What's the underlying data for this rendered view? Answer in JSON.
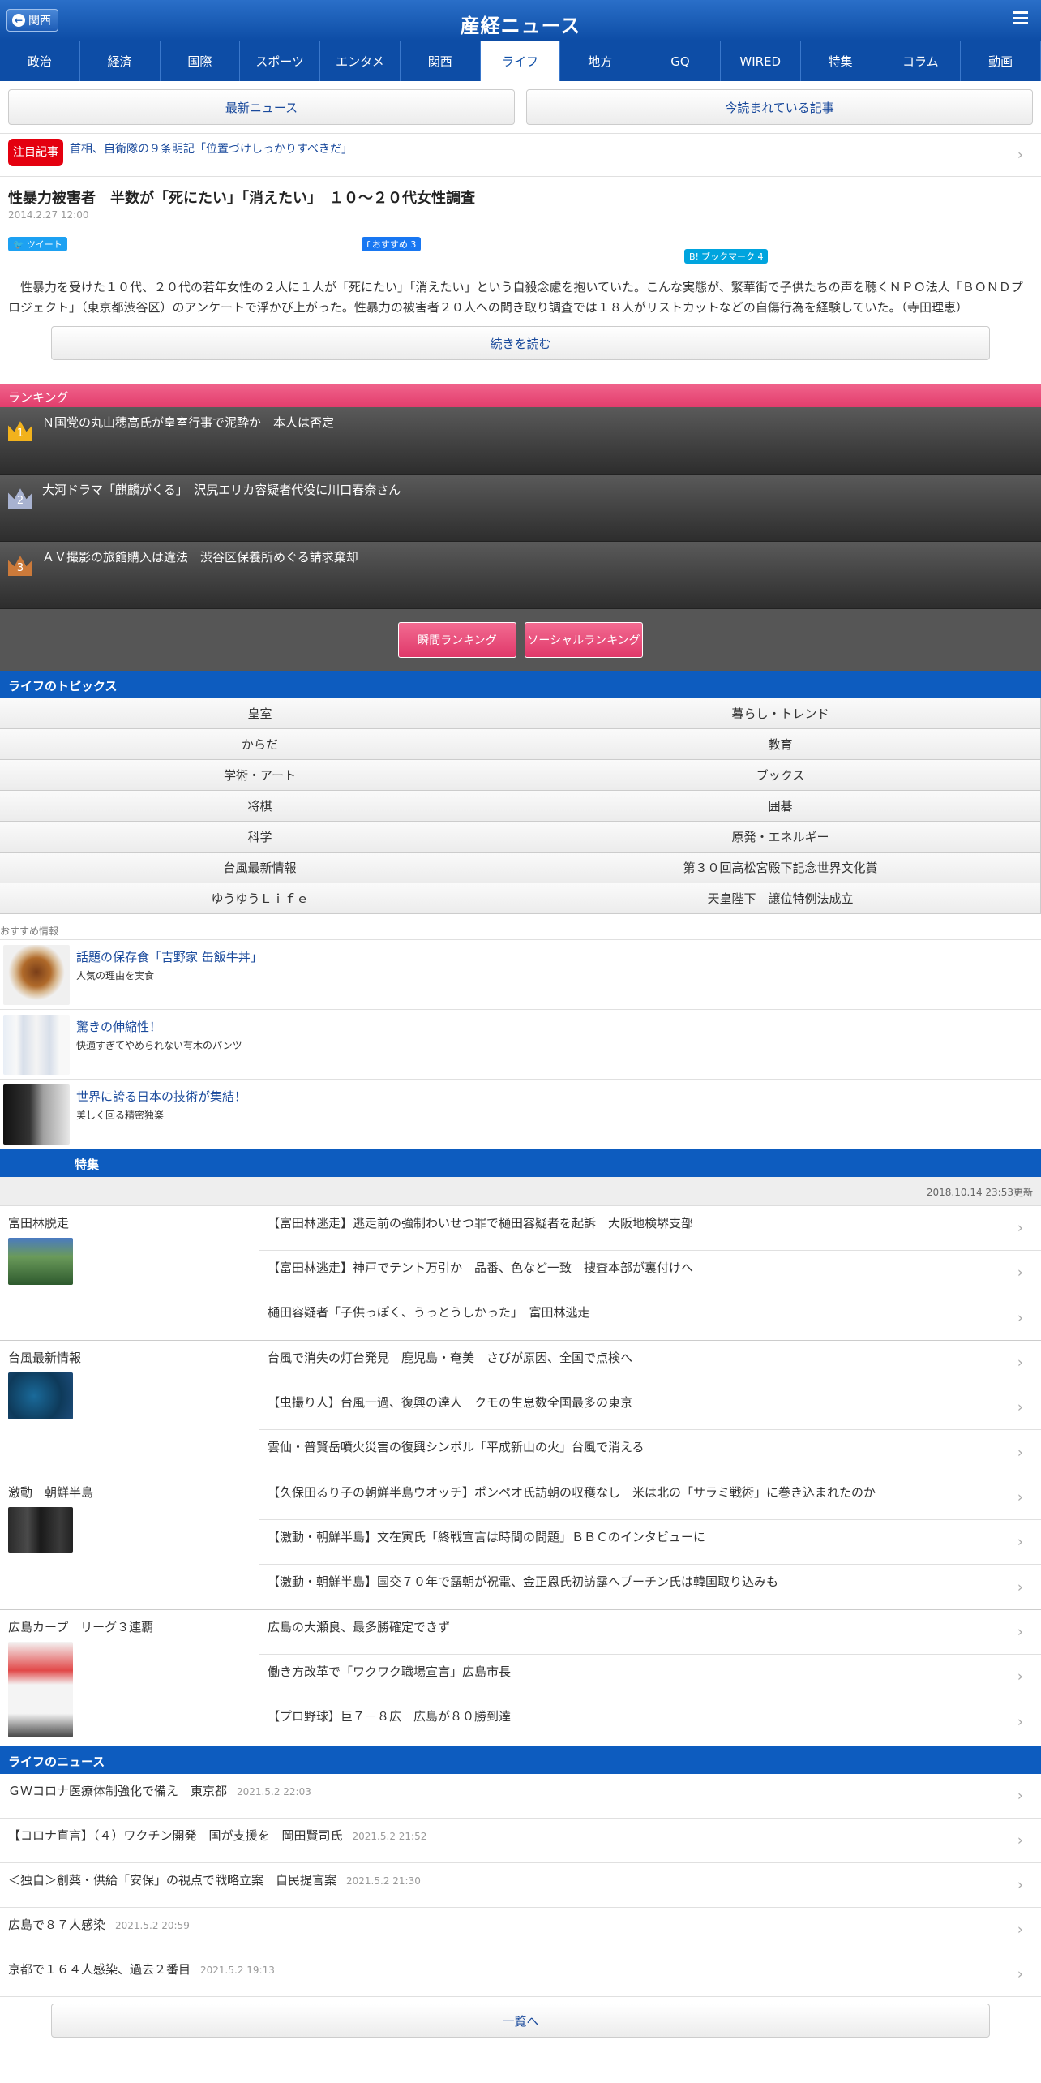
{
  "header": {
    "back_label": "関西",
    "logo": "産経ニュース"
  },
  "nav": [
    "政治",
    "経済",
    "国際",
    "スポーツ",
    "エンタメ",
    "関西",
    "ライフ",
    "地方",
    "GQ",
    "WIRED",
    "特集",
    "コラム",
    "動画"
  ],
  "nav_active": "ライフ",
  "top_buttons": {
    "latest": "最新ニュース",
    "reading": "今読まれている記事"
  },
  "notice": {
    "badge": "注目記事",
    "text": "首相、自衛隊の９条明記「位置づけしっかりすべきだ」"
  },
  "article": {
    "title": "性暴力被害者　半数が「死にたい」「消えたい」　１０～２０代女性調査",
    "date": "2014.2.27 12:00",
    "tweet": "ツイート",
    "fb": "おすすめ 3",
    "hatena": "ブックマーク 4",
    "lead": "性暴力を受けた１０代、２０代の若年女性の２人に１人が「死にたい」「消えたい」という自殺念慮を抱いていた。こんな実態が、繁華街で子供たちの声を聴くＮＰＯ法人「ＢＯＮＤプロジェクト」（東京都渋谷区）のアンケートで浮かび上がった。性暴力の被害者２０人への聞き取り調査では１８人がリストカットなどの自傷行為を経験していた。（寺田理恵）",
    "read_more": "続きを読む"
  },
  "ranking": {
    "title": "ランキング",
    "items": [
      {
        "rank": "1",
        "text": "Ｎ国党の丸山穂高氏が皇室行事で泥酔か　本人は否定"
      },
      {
        "rank": "2",
        "text": "大河ドラマ「麒麟がくる」　沢尻エリカ容疑者代役に川口春奈さん"
      },
      {
        "rank": "3",
        "text": "ＡＶ撮影の旅館購入は違法　渋谷区保養所めぐる請求棄却"
      }
    ],
    "btn_instant": "瞬間ランキング",
    "btn_social": "ソーシャルランキング"
  },
  "topics": {
    "title": "ライフのトピックス",
    "items": [
      "皇室",
      "暮らし・トレンド",
      "からだ",
      "教育",
      "学術・アート",
      "ブックス",
      "将棋",
      "囲碁",
      "科学",
      "原発・エネルギー",
      "台風最新情報",
      "第３０回高松宮殿下記念世界文化賞",
      "ゆうゆうＬｉｆｅ",
      "天皇陛下　譲位特例法成立"
    ]
  },
  "recommend": {
    "label": "おすすめ情報",
    "items": [
      {
        "title": "話題の保存食「吉野家 缶飯牛丼」",
        "sub": "人気の理由を実食"
      },
      {
        "title": "驚きの伸縮性！",
        "sub": "快適すぎてやめられない有木のパンツ"
      },
      {
        "title": "世界に誇る日本の技術が集結！",
        "sub": "美しく回る精密独楽"
      }
    ]
  },
  "feature": {
    "title": "特集",
    "updated": "2018.10.14 23:53更新",
    "rows": [
      {
        "name": "富田林脱走",
        "links": [
          "【富田林逃走】逃走前の強制わいせつ罪で樋田容疑者を起訴　大阪地検堺支部",
          "【富田林逃走】神戸でテント万引か　品番、色など一致　捜査本部が裏付けへ",
          "樋田容疑者「子供っぽく、うっとうしかった」　富田林逃走"
        ]
      },
      {
        "name": "台風最新情報",
        "links": [
          "台風で消失の灯台発見　鹿児島・奄美　さびが原因、全国で点検へ",
          "【虫撮り人】台風一過、復興の達人　クモの生息数全国最多の東京",
          "雲仙・普賢岳噴火災害の復興シンボル「平成新山の火」台風で消える"
        ]
      },
      {
        "name": "激動　朝鮮半島",
        "links": [
          "【久保田るり子の朝鮮半島ウオッチ】ポンペオ氏訪朝の収穫なし　米は北の「サラミ戦術」に巻き込まれたのか",
          "【激動・朝鮮半島】文在寅氏「終戦宣言は時間の問題」ＢＢＣのインタビューに",
          "【激動・朝鮮半島】国交７０年で露朝が祝電、金正恩氏初訪露へプーチン氏は韓国取り込みも"
        ]
      },
      {
        "name": "広島カープ　リーグ３連覇",
        "links": [
          "広島の大瀬良、最多勝確定できず",
          "働き方改革で「ワクワク職場宣言」広島市長",
          "【プロ野球】巨７－８広　広島が８０勝到達"
        ]
      }
    ]
  },
  "news": {
    "title": "ライフのニュース",
    "items": [
      {
        "text": "ＧＷコロナ医療体制強化で備え　東京都",
        "time": "2021.5.2 22:03"
      },
      {
        "text": "【コロナ直言】（４）ワクチン開発　国が支援を　岡田賢司氏",
        "time": "2021.5.2 21:52"
      },
      {
        "text": "＜独自＞創薬・供給「安保」の視点で戦略立案　自民提言案",
        "time": "2021.5.2 21:30"
      },
      {
        "text": "広島で８７人感染",
        "time": "2021.5.2 20:59"
      },
      {
        "text": "京都で１６４人感染、過去２番目",
        "time": "2021.5.2 19:13"
      }
    ],
    "all_btn": "一覧へ"
  }
}
